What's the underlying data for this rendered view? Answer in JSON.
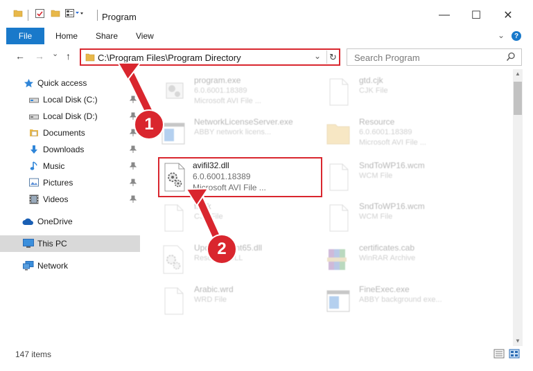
{
  "window": {
    "title": "Program",
    "minimize": "—",
    "maximize": "☐",
    "close": "✕"
  },
  "ribbon": {
    "tabs": [
      "File",
      "Home",
      "Share",
      "View"
    ],
    "collapse": "⌄",
    "help": "?"
  },
  "address": {
    "path": "C:\\Program Files\\Program Directory",
    "back": "←",
    "forward": "→",
    "recent": "⌄",
    "up": "↑",
    "dropdown": "⌄",
    "refresh": "↻"
  },
  "search": {
    "placeholder": "Search Program"
  },
  "sidebar": {
    "items": [
      {
        "label": "Quick access",
        "icon": "star-icon"
      },
      {
        "label": "Local Disk (C:)",
        "icon": "drive-icon",
        "pinned": true
      },
      {
        "label": "Local Disk (D:)",
        "icon": "drive-icon",
        "pinned": true
      },
      {
        "label": "Documents",
        "icon": "documents-icon",
        "pinned": true
      },
      {
        "label": "Downloads",
        "icon": "download-icon",
        "pinned": true
      },
      {
        "label": "Music",
        "icon": "music-icon",
        "pinned": true
      },
      {
        "label": "Pictures",
        "icon": "pictures-icon",
        "pinned": true
      },
      {
        "label": "Videos",
        "icon": "videos-icon",
        "pinned": true
      },
      {
        "label": "OneDrive",
        "icon": "cloud-icon"
      },
      {
        "label": "This PC",
        "icon": "computer-icon",
        "selected": true
      },
      {
        "label": "Network",
        "icon": "network-icon"
      }
    ],
    "pin_glyph": "📌"
  },
  "files": [
    {
      "name": "program.exe",
      "line2": "6.0.6001.18389",
      "line3": "Microsoft AVI File ...",
      "icon": "exe-icon"
    },
    {
      "name": "gtd.cjk",
      "line2": "CJK File",
      "line3": "",
      "icon": "blank-file-icon"
    },
    {
      "name": "NetworkLicenseServer.exe",
      "line2": "ABBY network licens...",
      "line3": "",
      "icon": "app-window-icon"
    },
    {
      "name": "Resource",
      "line2": "6.0.6001.18389",
      "line3": "Microsoft AVI File ...",
      "icon": "folder-icon"
    },
    {
      "name": "avifil32.dll",
      "line2": "6.0.6001.18389",
      "line3": "Microsoft AVI File ...",
      "icon": "dll-gear-icon"
    },
    {
      "name": "SndToWP16.wcm",
      "line2": "WCM File",
      "line3": "",
      "icon": "blank-file-icon"
    },
    {
      "name": "ff.cjk",
      "line2": "CJK File",
      "line3": "",
      "icon": "blank-file-icon"
    },
    {
      "name": "SndToWP16.wcm",
      "line2": "WCM File",
      "line3": "",
      "icon": "blank-file-icon"
    },
    {
      "name": "UpdateClient65.dll",
      "line2": "Resource DLL",
      "line3": "",
      "icon": "dll-gear-icon"
    },
    {
      "name": "certificates.cab",
      "line2": "WinRAR Archive",
      "line3": "",
      "icon": "archive-icon"
    },
    {
      "name": "Arabic.wrd",
      "line2": "WRD File",
      "line3": "",
      "icon": "blank-file-icon"
    },
    {
      "name": "FineExec.exe",
      "line2": "ABBY background exe...",
      "line3": "",
      "icon": "app-window-icon"
    }
  ],
  "status": {
    "count": "147 items"
  },
  "annotations": {
    "badge1": "1",
    "badge2": "2"
  },
  "colors": {
    "accent": "#1979ca",
    "annotation_red": "#d9262e",
    "selected_bg": "#d9d9d9"
  }
}
